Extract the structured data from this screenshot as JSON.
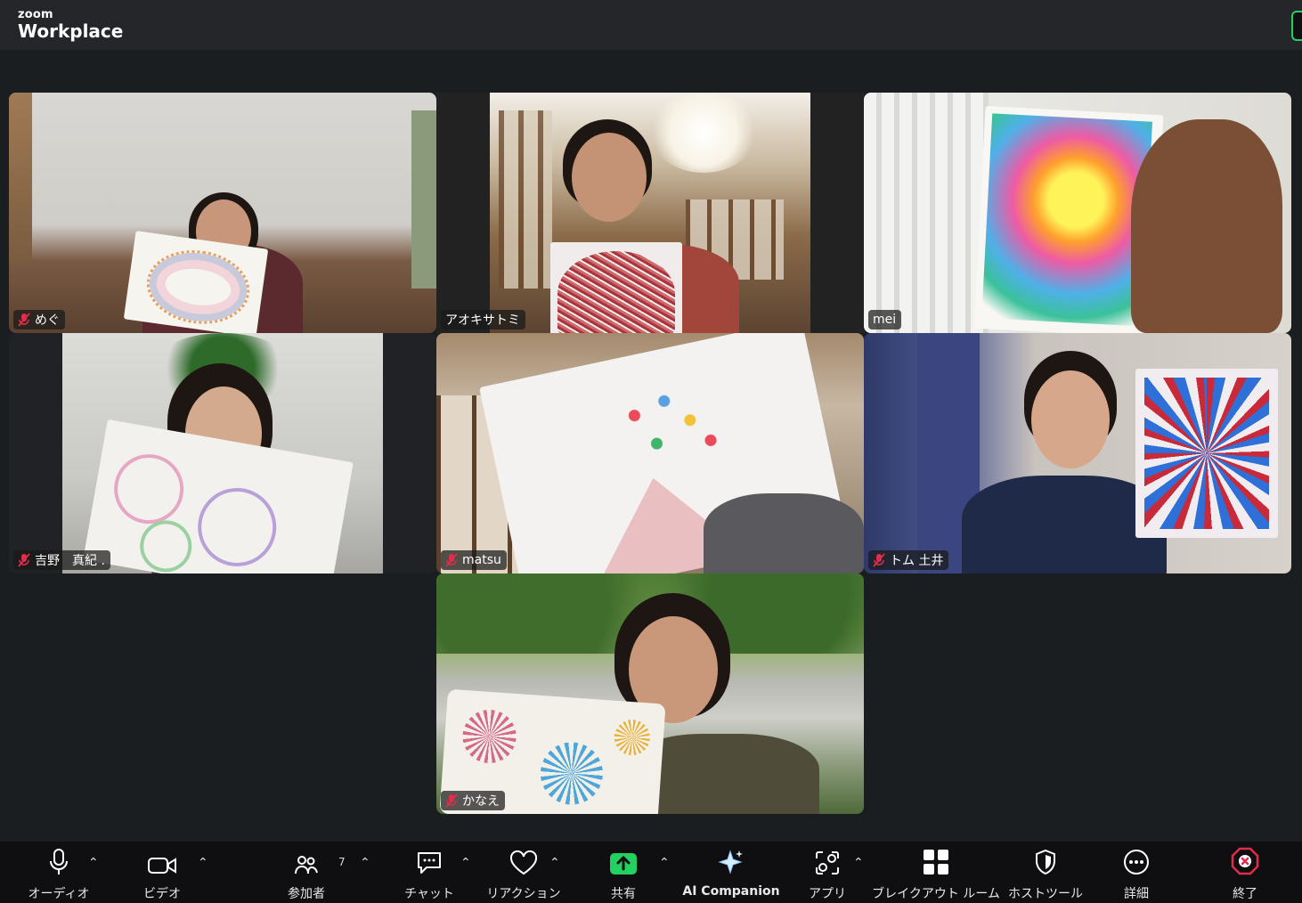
{
  "app": {
    "brand_top": "zoom",
    "brand_bottom": "Workplace"
  },
  "participants": [
    {
      "name": "めぐ",
      "muted": true
    },
    {
      "name": "アオキサトミ",
      "muted": false,
      "active_speaker": true
    },
    {
      "name": "mei",
      "muted": false
    },
    {
      "name": "吉野　真紀 .",
      "muted": true
    },
    {
      "name": "matsu",
      "muted": true
    },
    {
      "name": "トム 土井",
      "muted": true
    },
    {
      "name": "かなえ",
      "muted": true
    }
  ],
  "toolbar": {
    "audio": "オーディオ",
    "video": "ビデオ",
    "participants": "参加者",
    "participants_count": "7",
    "chat": "チャット",
    "reactions": "リアクション",
    "share": "共有",
    "ai": "AI Companion",
    "apps": "アプリ",
    "breakout": "ブレイクアウト ルーム",
    "host_tools": "ホストツール",
    "more": "詳細",
    "end": "終了"
  },
  "colors": {
    "active_border": "#2bdb7d",
    "share_green": "#23d160",
    "end_red": "#e02d4b"
  },
  "icons": [
    "microphone-icon",
    "camera-icon",
    "participants-icon",
    "chat-icon",
    "heart-icon",
    "share-arrow-icon",
    "sparkle-icon",
    "apps-icon",
    "grid-icon",
    "shield-icon",
    "ellipsis-icon",
    "close-icon",
    "muted-mic-icon"
  ]
}
